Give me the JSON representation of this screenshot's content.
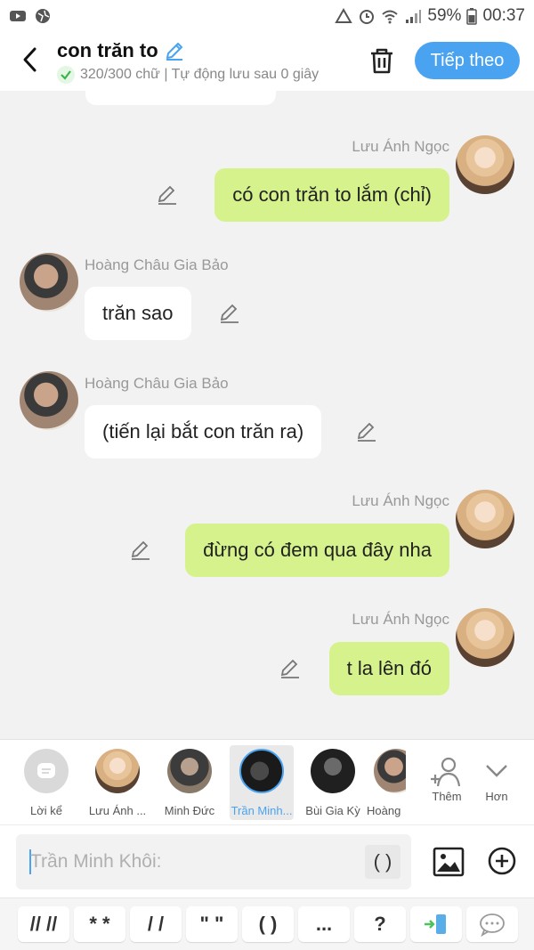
{
  "status": {
    "battery": "59%",
    "time": "00:37"
  },
  "header": {
    "title": "con trăn to",
    "subtitle": "320/300 chữ | Tự động lưu sau 0 giây",
    "next_label": "Tiếp theo"
  },
  "messages": [
    {
      "sender": "Lưu Ánh Ngọc",
      "text": "có con trăn to lắm (chỉ)",
      "side": "right"
    },
    {
      "sender": "Hoàng Châu Gia Bảo",
      "text": "trăn sao",
      "side": "left"
    },
    {
      "sender": "Hoàng Châu Gia Bảo",
      "text": "(tiến lại bắt con trăn ra)",
      "side": "left"
    },
    {
      "sender": "Lưu Ánh Ngọc",
      "text": "đừng có đem qua đây nha",
      "side": "right"
    },
    {
      "sender": "Lưu Ánh Ngọc",
      "text": "t la lên đó",
      "side": "right"
    }
  ],
  "characters": [
    {
      "name": "Lời kể"
    },
    {
      "name": "Lưu Ánh ..."
    },
    {
      "name": "Minh Đức"
    },
    {
      "name": "Trần Minh..."
    },
    {
      "name": "Bùi Gia Kỳ"
    },
    {
      "name": "Hoàng"
    }
  ],
  "char_actions": {
    "add_label": "Thêm",
    "more_label": "Hơn"
  },
  "input": {
    "placeholder": "Trần Minh Khôi:",
    "paren_label": "( )"
  },
  "quick_keys": [
    "// //",
    "* *",
    "/ /",
    "\" \"",
    "( )",
    "...",
    "?"
  ]
}
